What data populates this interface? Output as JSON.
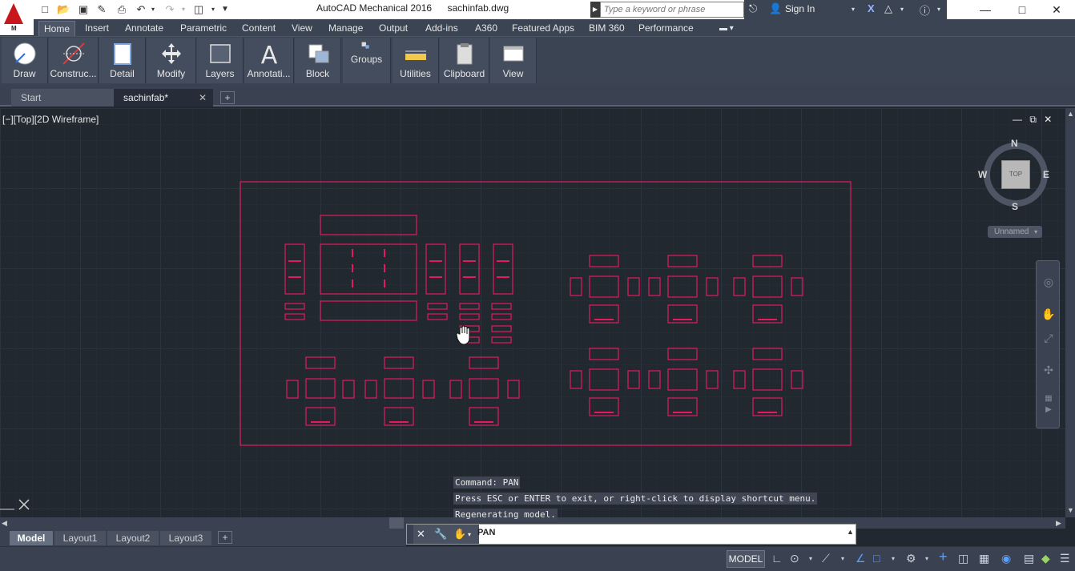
{
  "titlebar": {
    "app_name": "AutoCAD Mechanical 2016",
    "file_name": "sachinfab.dwg",
    "search_placeholder": "Type a keyword or phrase",
    "sign_in": "Sign In",
    "logo_letter": "M"
  },
  "ribbon_tabs": [
    "Home",
    "Insert",
    "Annotate",
    "Parametric",
    "Content",
    "View",
    "Manage",
    "Output",
    "Add-ins",
    "A360",
    "Featured Apps",
    "BIM 360",
    "Performance"
  ],
  "ribbon_panels": [
    "Draw",
    "Construc...",
    "Detail",
    "Modify",
    "Layers",
    "Annotati...",
    "Block",
    "Groups",
    "Utilities",
    "Clipboard",
    "View"
  ],
  "file_tabs": {
    "start": "Start",
    "active": "sachinfab*"
  },
  "viewport": {
    "label": "[−][Top][2D Wireframe]",
    "viewcube": {
      "face": "TOP",
      "n": "N",
      "s": "S",
      "e": "E",
      "w": "W"
    },
    "ucs_name": "Unnamed"
  },
  "command": {
    "history": [
      "Command: PAN",
      "Press ESC or ENTER to exit, or right-click to display shortcut menu.",
      "Regenerating model."
    ],
    "current": "PAN"
  },
  "layout_tabs": [
    "Model",
    "Layout1",
    "Layout2",
    "Layout3"
  ],
  "statusbar": {
    "model": "MODEL"
  },
  "colors": {
    "drawing_lines": "#e6195f",
    "canvas": "#212830",
    "ribbon": "#3b4453"
  }
}
